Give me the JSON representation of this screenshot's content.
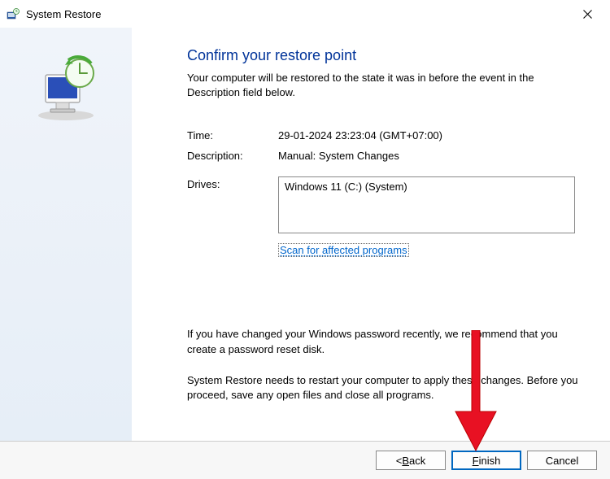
{
  "window": {
    "title": "System Restore",
    "close_label": "Close"
  },
  "main": {
    "heading": "Confirm your restore point",
    "subtitle": "Your computer will be restored to the state it was in before the event in the Description field below.",
    "time_label": "Time:",
    "time_value": "29-01-2024 23:23:04 (GMT+07:00)",
    "description_label": "Description:",
    "description_value": "Manual: System Changes",
    "drives_label": "Drives:",
    "drives_value": "Windows 11 (C:) (System)",
    "scan_link": "Scan for affected programs",
    "warning1": "If you have changed your Windows password recently, we recommend that you create a password reset disk.",
    "warning2": "System Restore needs to restart your computer to apply these changes. Before you proceed, save any open files and close all programs."
  },
  "footer": {
    "back_prefix": "< ",
    "back_char": "B",
    "back_rest": "ack",
    "finish_char": "F",
    "finish_rest": "inish",
    "cancel": "Cancel"
  }
}
